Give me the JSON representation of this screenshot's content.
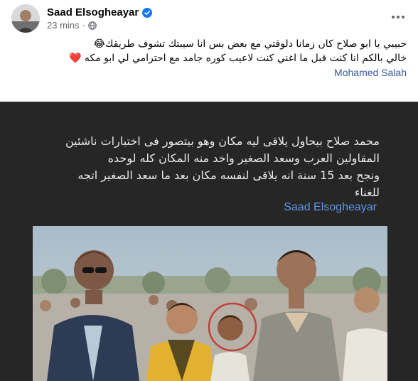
{
  "post": {
    "author": "Saad Elsogheayar",
    "time": "23 mins",
    "meta_separator": "·",
    "caption_lines": [
      "حبيبي يا ابو صلاح  كان زمانا دلوقتي مع بعض  بس انا سيبتك   تشوف طريقك😂",
      "خالي  بالكم انا كنت قبل ما اغني كنت لاعيب كوره جامد مع احترامي لي  ابو مكه ❤️"
    ],
    "mention": "Mohamed Salah"
  },
  "image_overlay": {
    "lines": [
      "محمد صلاح بيحاول يلاقى ليه مكان وهو بيتصور فى اختبارات ناشئين",
      "المقاولين العرب وسعد الصغير واخد منه المكان كله لوحده",
      "ونجح بعد 15 سنة انه يلاقى لنفسه مكان بعد ما سعد الصغير اتجه",
      "للغناء"
    ],
    "author": "Saad Elsogheayar"
  },
  "colors": {
    "background": "#ffffff",
    "link": "#385898",
    "secondary_text": "#65676b",
    "verified_badge": "#1877f2",
    "image_background": "#262626",
    "overlay_text": "#eaeaea",
    "overlay_author": "#5d97e8",
    "highlight_circle": "#c2413a"
  },
  "icons": {
    "verified": "verified-badge-icon",
    "audience": "globe-icon",
    "menu": "more-options-icon"
  }
}
